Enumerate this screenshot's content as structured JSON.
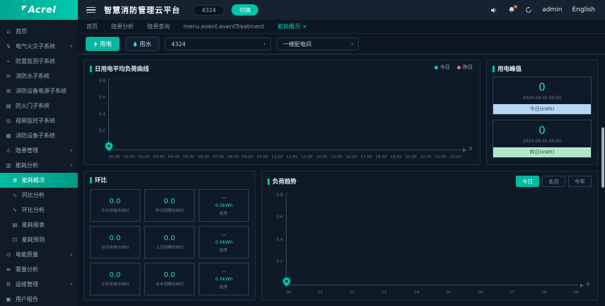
{
  "colors": {
    "accent": "#00c3a8",
    "legend_today": "#00d5b6",
    "legend_yesterday": "#f56c6c",
    "today_bar_bg": "#b9d6f2",
    "yesterday_bar_bg": "#b2e7c8"
  },
  "header": {
    "logo_text": "Acrel",
    "title": "智慧消防管理云平台",
    "badge": "4324",
    "switch_label": "切换",
    "user": "admin",
    "lang": "English"
  },
  "tabs": [
    {
      "label": "首页",
      "close": ""
    },
    {
      "label": "隐患分析",
      "close": ""
    },
    {
      "label": "隐患查询",
      "close": ""
    },
    {
      "label": "menu.event.eventTreatment",
      "close": ""
    },
    {
      "label": "能耗概况",
      "close": "×",
      "cls": "active"
    }
  ],
  "toolbar": {
    "electric_label": "用电",
    "water_label": "用水",
    "station_select": "4324",
    "room_select": "一楼配电间"
  },
  "sidebar": {
    "items": [
      {
        "icon": "⌂",
        "label": "首页",
        "arrow": ""
      },
      {
        "icon": "↯",
        "label": "电气火灾子系统",
        "arrow": "∨"
      },
      {
        "icon": "⌁",
        "label": "防雷监测子系统",
        "arrow": ""
      },
      {
        "icon": "≋",
        "label": "消防水子系统",
        "arrow": ""
      },
      {
        "icon": "⊞",
        "label": "消防设备电源子系统",
        "arrow": ""
      },
      {
        "icon": "▤",
        "label": "防火门子系统",
        "arrow": ""
      },
      {
        "icon": "◎",
        "label": "视频监控子系统",
        "arrow": ""
      },
      {
        "icon": "▦",
        "label": "消防设备子系统",
        "arrow": ""
      },
      {
        "icon": "⚠",
        "label": "隐患管理",
        "arrow": "∨"
      },
      {
        "icon": "▥",
        "label": "能耗分析",
        "arrow": "∧"
      },
      {
        "icon": "≣",
        "label": "能耗概况",
        "arrow": "",
        "cls": "sub active"
      },
      {
        "icon": "∿",
        "label": "同比分析",
        "arrow": "",
        "cls": "sub"
      },
      {
        "icon": "∿",
        "label": "环比分析",
        "arrow": "",
        "cls": "sub"
      },
      {
        "icon": "▤",
        "label": "能耗报表",
        "arrow": "",
        "cls": "sub"
      },
      {
        "icon": "⊡",
        "label": "能耗预测",
        "arrow": "",
        "cls": "sub"
      },
      {
        "icon": "⊙",
        "label": "电能质量",
        "arrow": "∨"
      },
      {
        "icon": "≡",
        "label": "需量分析",
        "arrow": ""
      },
      {
        "icon": "⚙",
        "label": "运维管理",
        "arrow": "∨"
      },
      {
        "icon": "▣",
        "label": "用户报告",
        "arrow": ""
      }
    ]
  },
  "panels": {
    "load_curve": {
      "title": "日用电平均负荷曲线",
      "legend": [
        {
          "label": "今日",
          "color": "#00d5b6"
        },
        {
          "label": "昨日",
          "color": "#f56c6c"
        }
      ],
      "yticks": [
        "0.8",
        "0.6",
        "0.4",
        "0.2"
      ],
      "xticks": [
        "00:00",
        "01:00",
        "02:00",
        "03:00",
        "04:00",
        "05:00",
        "06:00",
        "07:00",
        "08:00",
        "09:00",
        "10:00",
        "11:00",
        "12:00",
        "13:00",
        "14:00",
        "15:00",
        "16:00",
        "17:00",
        "18:00",
        "19:00",
        "20:00",
        "21:00",
        "22:00",
        "23:00"
      ],
      "end_label": "0"
    },
    "peak": {
      "title": "用电峰值",
      "cards": [
        {
          "value": "0",
          "date": "2020-04-02 00:00",
          "unit": "今日(kWh)",
          "cls": "blue"
        },
        {
          "value": "0",
          "date": "2020-04-01 00:00",
          "unit": "昨日(kWh)",
          "cls": "green"
        }
      ]
    },
    "huanbi": {
      "title": "环比",
      "cards": [
        {
          "value": "0.0",
          "sub": "",
          "label": "今日用电(kWh)"
        },
        {
          "value": "0.0",
          "sub": "",
          "label": "昨日同期(kWh)"
        },
        {
          "value": "--",
          "sub": "0.0kWh",
          "label": "趋势",
          "cls": "trend"
        },
        {
          "value": "0.0",
          "sub": "",
          "label": "当月用电(kWh)"
        },
        {
          "value": "0.0",
          "sub": "",
          "label": "上月同期(kWh)"
        },
        {
          "value": "--",
          "sub": "0.0kWh",
          "label": "趋势",
          "cls": "trend"
        },
        {
          "value": "0.0",
          "sub": "",
          "label": "今年用电(kWh)"
        },
        {
          "value": "0.0",
          "sub": "",
          "label": "去年同期(kWh)"
        },
        {
          "value": "--",
          "sub": "0.0kWh",
          "label": "趋势",
          "cls": "trend"
        }
      ]
    },
    "load_trend": {
      "title": "负荷趋势",
      "buttons": [
        {
          "label": "今日",
          "cls": "active"
        },
        {
          "label": "本月"
        },
        {
          "label": "今年"
        }
      ],
      "yticks": [
        "0.8",
        "0.6",
        "0.4",
        "0.2"
      ],
      "xticks": [
        "00",
        "01",
        "02",
        "03",
        "04",
        "05",
        "06",
        "07",
        "08",
        "09"
      ],
      "end_label": "0"
    }
  }
}
